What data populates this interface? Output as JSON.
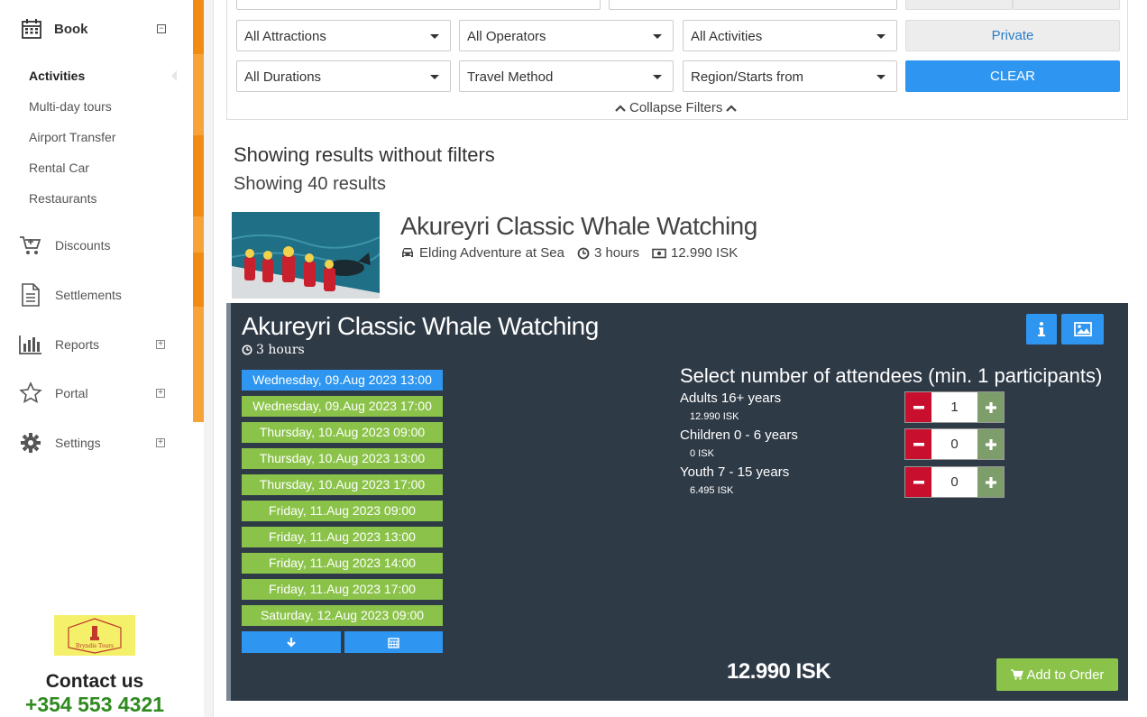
{
  "sidebar": {
    "book_label": "Book",
    "sub_items": [
      {
        "label": "Activities",
        "active": true
      },
      {
        "label": "Multi-day tours"
      },
      {
        "label": "Airport Transfer"
      },
      {
        "label": "Rental Car"
      },
      {
        "label": "Restaurants"
      }
    ],
    "nav": [
      {
        "label": "Discounts",
        "icon": "cart-icon"
      },
      {
        "label": "Settlements",
        "icon": "document-icon"
      },
      {
        "label": "Reports",
        "icon": "bar-chart-icon",
        "expandable": true
      },
      {
        "label": "Portal",
        "icon": "star-icon",
        "expandable": true
      },
      {
        "label": "Settings",
        "icon": "gear-icon",
        "expandable": true
      }
    ],
    "logo_text": "Bryndis Tours",
    "contact_title": "Contact us",
    "contact_phone": "+354 553 4321"
  },
  "filters": {
    "attractions": "All Attractions",
    "operators": "All Operators",
    "activities": "All Activities",
    "durations": "All Durations",
    "travel_method": "Travel Method",
    "region": "Region/Starts from",
    "private_label": "Private",
    "clear_label": "CLEAR",
    "collapse_label": "Collapse Filters"
  },
  "results": {
    "heading": "Showing results without filters",
    "count_text": "Showing 40 results"
  },
  "tour": {
    "title": "Akureyri Classic Whale Watching",
    "operator": "Elding Adventure at Sea",
    "duration": "3 hours",
    "price": "12.990 ISK"
  },
  "booking": {
    "title": "Akureyri Classic Whale Watching",
    "duration": "3 hours",
    "dates": [
      {
        "label": "Wednesday, 09.Aug 2023 13:00",
        "selected": true
      },
      {
        "label": "Wednesday, 09.Aug 2023 17:00"
      },
      {
        "label": "Thursday, 10.Aug 2023 09:00"
      },
      {
        "label": "Thursday, 10.Aug 2023 13:00"
      },
      {
        "label": "Thursday, 10.Aug 2023 17:00"
      },
      {
        "label": "Friday, 11.Aug 2023 09:00"
      },
      {
        "label": "Friday, 11.Aug 2023 13:00"
      },
      {
        "label": "Friday, 11.Aug 2023 14:00"
      },
      {
        "label": "Friday, 11.Aug 2023 17:00"
      },
      {
        "label": "Saturday, 12.Aug 2023 09:00"
      }
    ],
    "attendees_title": "Select number of attendees (min. 1 participants)",
    "attendees": [
      {
        "name": "Adults 16+ years",
        "price": "12.990 ISK",
        "count": "1"
      },
      {
        "name": "Children 0 - 6 years",
        "price": "0 ISK",
        "count": "0"
      },
      {
        "name": "Youth 7 - 15 years",
        "price": "6.495 ISK",
        "count": "0"
      }
    ],
    "total": "12.990 ISK",
    "add_label": "Add to Order"
  },
  "colors": {
    "accent_orange": "#f7a33a",
    "primary_blue": "#2e96f0",
    "date_green": "#8bc34a",
    "panel_dark": "#2f3a47",
    "minus_red": "#c8102e"
  }
}
